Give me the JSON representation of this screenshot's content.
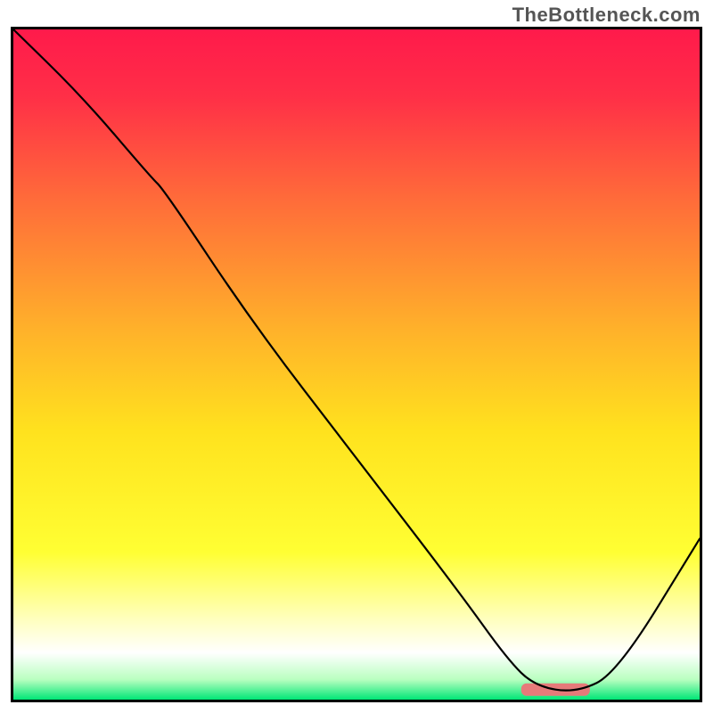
{
  "watermark": "TheBottleneck.com",
  "chart_data": {
    "type": "line",
    "title": "",
    "xlabel": "",
    "ylabel": "",
    "xlim": [
      0,
      100
    ],
    "ylim": [
      0,
      100
    ],
    "grid": false,
    "legend": false,
    "background_gradient": {
      "stops": [
        {
          "offset": 0.0,
          "color": "#ff1a4b"
        },
        {
          "offset": 0.1,
          "color": "#ff2f47"
        },
        {
          "offset": 0.25,
          "color": "#ff6a3a"
        },
        {
          "offset": 0.45,
          "color": "#ffb22a"
        },
        {
          "offset": 0.6,
          "color": "#ffe21e"
        },
        {
          "offset": 0.78,
          "color": "#ffff33"
        },
        {
          "offset": 0.88,
          "color": "#ffffbe"
        },
        {
          "offset": 0.93,
          "color": "#ffffff"
        },
        {
          "offset": 0.97,
          "color": "#b9ffc0"
        },
        {
          "offset": 1.0,
          "color": "#00e676"
        }
      ]
    },
    "series": [
      {
        "name": "bottleneck-curve",
        "x": [
          0,
          10,
          20,
          22,
          35,
          50,
          65,
          72,
          76,
          82,
          88,
          100
        ],
        "y": [
          100,
          90,
          78,
          76,
          56,
          36,
          16,
          6,
          2,
          1,
          4,
          24
        ]
      }
    ],
    "marker": {
      "name": "optimal-range",
      "shape": "rounded-bar",
      "x_start": 74,
      "x_end": 84,
      "y": 1.5,
      "color": "#e67a7a"
    }
  }
}
